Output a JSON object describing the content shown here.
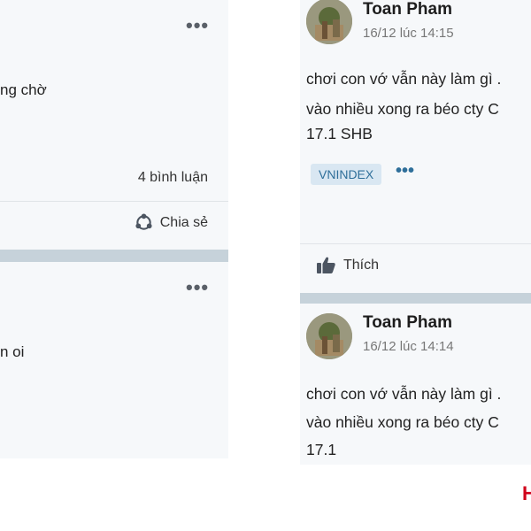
{
  "left_feed": {
    "card1": {
      "text_fragment": "ng chờ",
      "comment_count": "4 bình luận",
      "share_label": "Chia sẻ"
    },
    "card2": {
      "text_fragment": "n oi"
    }
  },
  "right_feed": {
    "posts": [
      {
        "author": "Toan Pham",
        "timestamp": "16/12 lúc 14:15",
        "lines": [
          "chơi con vớ vẫn này làm gì .",
          "vào nhiều xong ra béo cty C",
          "17.1 SHB"
        ],
        "tag": "VNINDEX",
        "like_label": "Thích"
      },
      {
        "author": "Toan Pham",
        "timestamp": "16/12 lúc 14:14",
        "lines": [
          "chơi con vớ vẫn này làm gì .",
          "vào nhiều xong ra béo cty C",
          "17.1"
        ]
      }
    ]
  },
  "bottom_fragment": "H",
  "colors": {
    "card_bg": "#f6f8fa",
    "separator": "#c6d2da",
    "tag_bg": "#d9e7f2",
    "tag_text": "#2f6f9a",
    "accent_red": "#d0021b"
  },
  "icons": {
    "more": "more-horizontal-icon",
    "share": "share-icon",
    "like": "thumbs-up-icon"
  }
}
